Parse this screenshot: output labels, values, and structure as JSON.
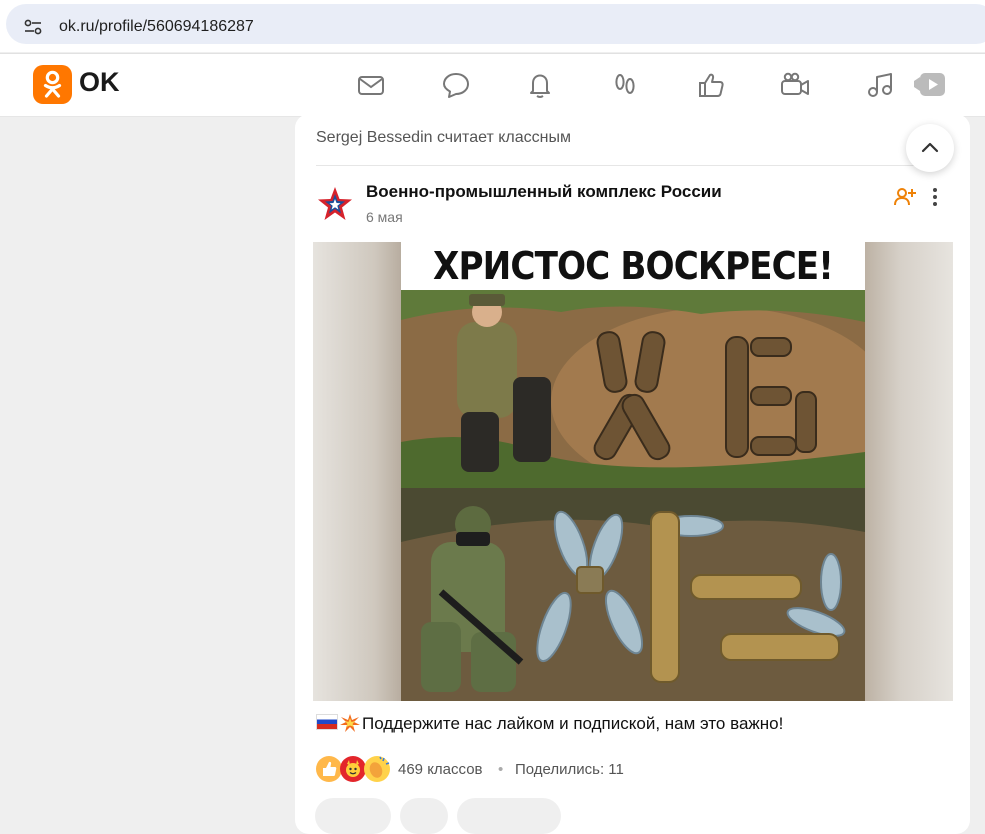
{
  "browser": {
    "url": "ok.ru/profile/560694186287",
    "site_info_icon": "tune-icon"
  },
  "header": {
    "logo_text": "OK",
    "brand_color": "#ff7700",
    "nav_icons": [
      "mail-icon",
      "chat-icon",
      "bell-icon",
      "guests-icon",
      "like-icon",
      "video-camera-icon",
      "music-icon",
      "video-icon"
    ]
  },
  "feed": {
    "liked_by": "Sergej Bessedin считает классным",
    "post": {
      "group_name": "Военно-промышленный комплекс России",
      "date": "6 мая",
      "image_title": "ХРИСТОС ВОСКРЕСЕ!",
      "text": "Поддержите нас лайком и подпиской, нам это важно!",
      "class_count": "469 классов",
      "separator": "•",
      "shared": "Поделились: 11"
    }
  }
}
